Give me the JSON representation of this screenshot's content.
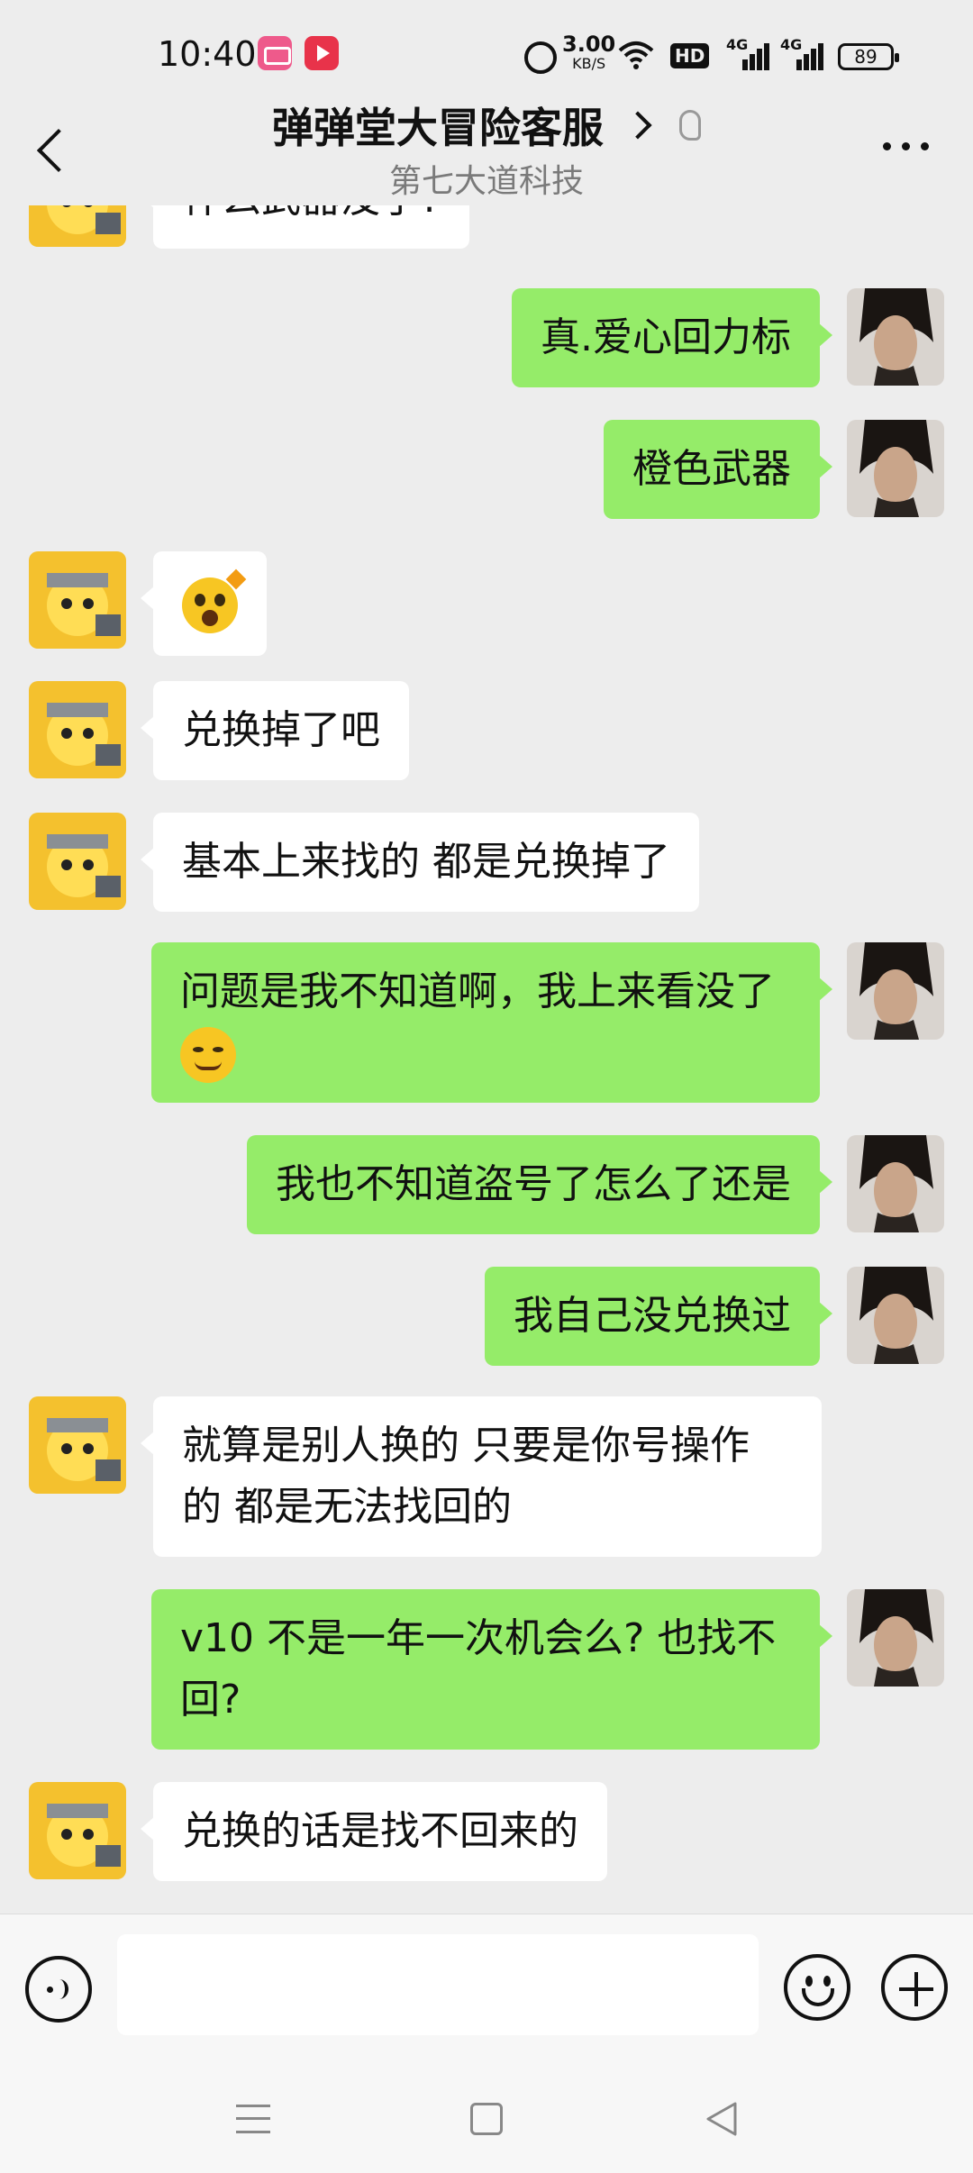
{
  "status_bar": {
    "time": "10:40",
    "net_speed_value": "3.00",
    "net_speed_unit": "KB/S",
    "hd_label": "HD",
    "signal1_label": "4G",
    "signal2_label": "4G",
    "battery": "89"
  },
  "header": {
    "title": "弹弹堂大冒险客服",
    "subtitle": "第七大道科技"
  },
  "messages": [
    {
      "side": "left",
      "text": "什么武器没了?"
    },
    {
      "side": "right",
      "text": "真.爱心回力标"
    },
    {
      "side": "right",
      "text": "橙色武器"
    },
    {
      "side": "left",
      "emoji": "surprised-emoji"
    },
    {
      "side": "left",
      "text": "兑换掉了吧"
    },
    {
      "side": "left",
      "text": "基本上来找的 都是兑换掉了"
    },
    {
      "side": "right",
      "text": "问题是我不知道啊，我上来看没了",
      "emoji": "awkward-smile-emoji"
    },
    {
      "side": "right",
      "text": "我也不知道盗号了怎么了还是"
    },
    {
      "side": "right",
      "text": "我自己没兑换过"
    },
    {
      "side": "left",
      "text_line1": "就算是别人换的 只要是你号操作",
      "text_line2": "的 都是无法找回的"
    },
    {
      "side": "right",
      "text_line1": "v10 不是一年一次机会么? 也找不",
      "text_line2": "回?"
    },
    {
      "side": "left",
      "text": "兑换的话是找不回来的"
    }
  ],
  "colors": {
    "sent_bubble": "#95ec69",
    "received_bubble": "#ffffff",
    "background": "#ededed"
  }
}
